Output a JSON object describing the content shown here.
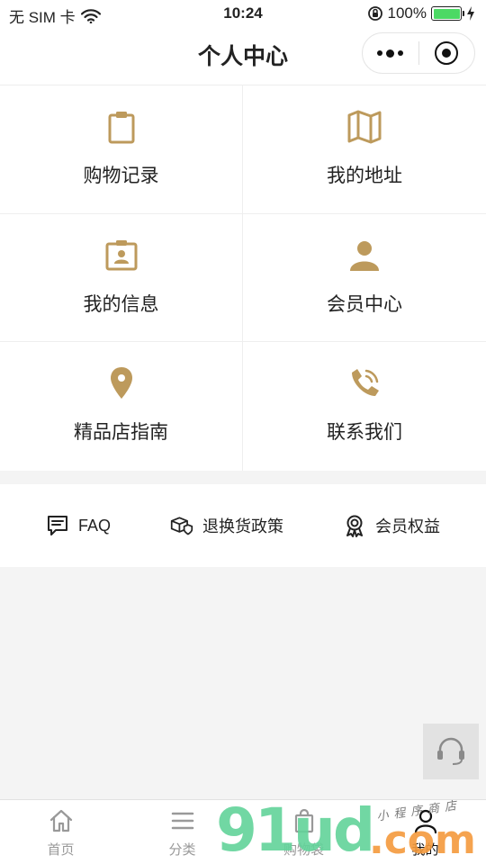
{
  "status_bar": {
    "carrier": "无 SIM 卡",
    "time": "10:24",
    "battery": "100%",
    "battery_level": 1.0,
    "battery_color": "#4cd964"
  },
  "nav": {
    "title": "个人中心",
    "more_icon": "more-dots-icon",
    "close_icon": "target-circle-icon"
  },
  "accent_color": "#bd9a5c",
  "grid": [
    {
      "label": "购物记录",
      "icon": "clipboard-icon"
    },
    {
      "label": "我的地址",
      "icon": "map-icon"
    },
    {
      "label": "我的信息",
      "icon": "id-card-icon"
    },
    {
      "label": "会员中心",
      "icon": "user-icon"
    },
    {
      "label": "精品店指南",
      "icon": "location-pin-icon"
    },
    {
      "label": "联系我们",
      "icon": "phone-icon"
    }
  ],
  "links": [
    {
      "label": "FAQ",
      "icon": "chat-list-icon"
    },
    {
      "label": "退换货政策",
      "icon": "package-shield-icon"
    },
    {
      "label": "会员权益",
      "icon": "badge-icon"
    }
  ],
  "service_button": {
    "icon": "headset-icon"
  },
  "tabs": [
    {
      "label": "首页",
      "icon": "home-icon",
      "active": false
    },
    {
      "label": "分类",
      "icon": "menu-icon",
      "active": false
    },
    {
      "label": "购物袋",
      "icon": "shopping-bag-icon",
      "active": false
    },
    {
      "label": "我的",
      "icon": "profile-icon",
      "active": true
    }
  ],
  "watermark": {
    "number": "91ud",
    "suffix": ".com",
    "text": "小程序商店"
  }
}
